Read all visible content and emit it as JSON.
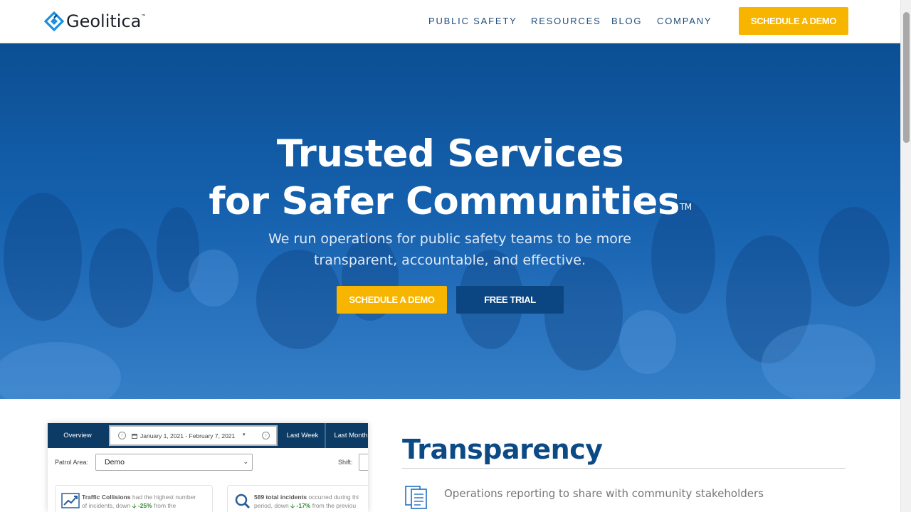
{
  "header": {
    "brand": "Geolitica",
    "brand_tm": "™",
    "nav": [
      {
        "label": "PUBLIC SAFETY"
      },
      {
        "label": "RESOURCES"
      },
      {
        "label": "BLOG"
      },
      {
        "label": "COMPANY"
      }
    ],
    "cta_label": "SCHEDULE A DEMO"
  },
  "hero": {
    "title_line1": "Trusted Services",
    "title_line2": "for Safer Communities",
    "title_tm": "TM",
    "subtitle_line1": "We run operations for public safety teams to be more",
    "subtitle_line2": "transparent, accountable, and effective.",
    "primary_label": "SCHEDULE A DEMO",
    "secondary_label": "FREE TRIAL"
  },
  "dashboard": {
    "tab_overview": "Overview",
    "date_range": "January 1, 2021 - February 7, 2021",
    "tab_last_week": "Last Week",
    "tab_last_month": "Last Month",
    "patrol_area_label": "Patrol Area:",
    "patrol_area_value": "Demo",
    "shift_label": "Shift:",
    "card1": {
      "title": "Traffic Collisions",
      "line1_rest": " had the highest number",
      "line2_pre": "of incidents, down ",
      "pct": "-25%",
      "line2_post": " from the"
    },
    "card2": {
      "title": "589 total incidents",
      "line1_rest": " occurred during thi",
      "line2_pre": "period, down ",
      "pct": "-17%",
      "line2_post": " from the previou"
    }
  },
  "section": {
    "title": "Transparency",
    "feature_text": "Operations reporting to share with community stakeholders"
  },
  "colors": {
    "accent_yellow": "#f7b500",
    "navy": "#0b4582",
    "hero_blue": "#1560ad",
    "title_blue": "#0c4a86"
  },
  "icons": [
    "geolitica-logo-icon",
    "calendar-icon",
    "chevron-left-icon",
    "chevron-right-icon",
    "trend-chart-icon",
    "magnifier-icon",
    "document-icon"
  ]
}
